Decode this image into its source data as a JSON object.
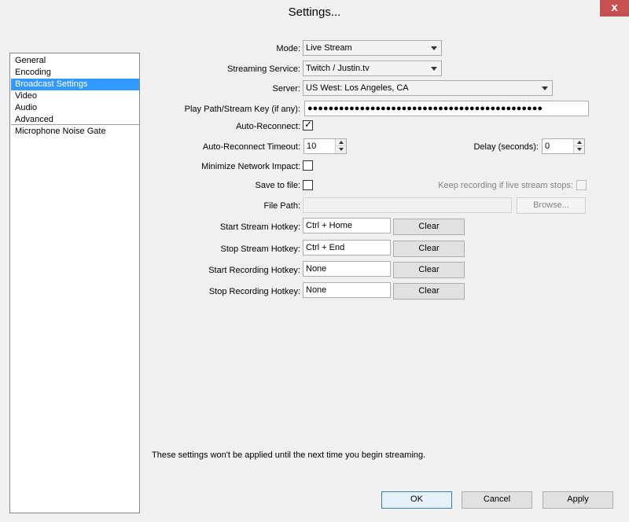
{
  "window": {
    "title": "Settings...",
    "close_glyph": "x"
  },
  "sidebar": {
    "items": [
      {
        "label": "General"
      },
      {
        "label": "Encoding"
      },
      {
        "label": "Broadcast Settings"
      },
      {
        "label": "Video"
      },
      {
        "label": "Audio"
      },
      {
        "label": "Advanced"
      },
      {
        "label": "Microphone Noise Gate"
      }
    ],
    "selected": "Broadcast Settings"
  },
  "broadcast": {
    "mode": {
      "label": "Mode:",
      "value": "Live Stream"
    },
    "service": {
      "label": "Streaming Service:",
      "value": "Twitch / Justin.tv"
    },
    "server": {
      "label": "Server:",
      "value": "US West: Los Angeles, CA"
    },
    "stream_key": {
      "label": "Play Path/Stream Key (if any):",
      "value": "●●●●●●●●●●●●●●●●●●●●●●●●●●●●●●●●●●●●●●●●●●●●●"
    },
    "auto_reconnect": {
      "label": "Auto-Reconnect:",
      "checked": true
    },
    "reconnect_timeout": {
      "label": "Auto-Reconnect Timeout:",
      "value": "10"
    },
    "delay": {
      "label": "Delay (seconds):",
      "value": "0"
    },
    "minimize_network": {
      "label": "Minimize Network Impact:",
      "checked": false
    },
    "save_to_file": {
      "label": "Save to file:",
      "checked": false
    },
    "keep_recording": {
      "label": "Keep recording if live stream stops:",
      "checked": false
    },
    "file_path": {
      "label": "File Path:",
      "value": ""
    },
    "browse_label": "Browse...",
    "hotkeys": [
      {
        "label": "Start Stream Hotkey:",
        "value": "Ctrl + Home",
        "clear": "Clear"
      },
      {
        "label": "Stop Stream Hotkey:",
        "value": "Ctrl + End",
        "clear": "Clear"
      },
      {
        "label": "Start Recording Hotkey:",
        "value": "None",
        "clear": "Clear"
      },
      {
        "label": "Stop Recording Hotkey:",
        "value": "None",
        "clear": "Clear"
      }
    ],
    "notice": "These settings won't be applied until the next time you begin streaming."
  },
  "footer": {
    "ok": "OK",
    "cancel": "Cancel",
    "apply": "Apply"
  },
  "colors": {
    "selection": "#3399ff",
    "close_button": "#c75050"
  }
}
